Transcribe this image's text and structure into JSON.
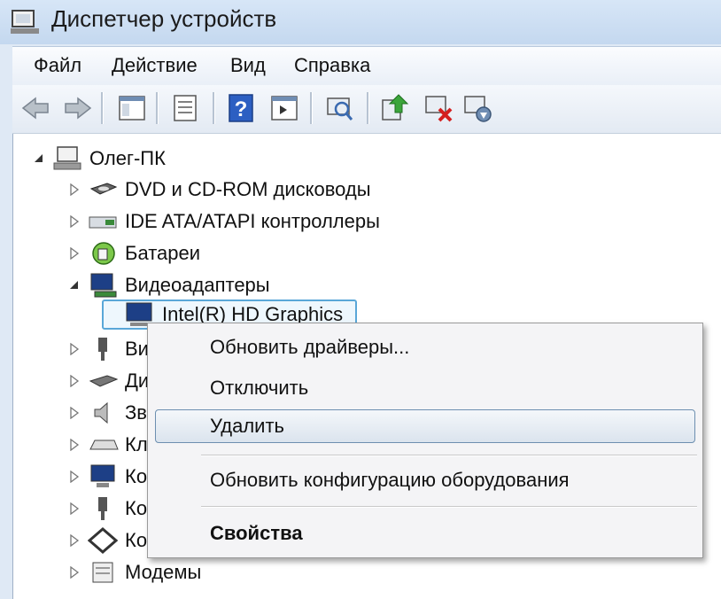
{
  "window": {
    "title": "Диспетчер устройств"
  },
  "menu": [
    "Файл",
    "Действие",
    "Вид",
    "Справка"
  ],
  "toolbar": {
    "buttons": [
      "back-icon",
      "forward-icon",
      "properties-window-icon",
      "list-view-icon",
      "help-icon",
      "panel-view-icon",
      "scan-hardware-icon",
      "update-driver-icon",
      "disable-device-icon",
      "uninstall-device-icon"
    ]
  },
  "tree": {
    "root": "Олег-ПК",
    "items": [
      {
        "label": "DVD и CD-ROM дисководы",
        "icon": "dvd-drive-icon"
      },
      {
        "label": "IDE ATA/ATAPI контроллеры",
        "icon": "ide-controller-icon"
      },
      {
        "label": "Батареи",
        "icon": "battery-icon"
      },
      {
        "label": "Видеоадаптеры",
        "icon": "display-adapter-icon"
      },
      {
        "label": "Intel(R) HD Graphics",
        "icon": "monitor-icon"
      },
      {
        "label": "Ви",
        "icon": "usb-plug-icon"
      },
      {
        "label": "Ди",
        "icon": "disk-drive-icon"
      },
      {
        "label": "Зв",
        "icon": "speaker-icon"
      },
      {
        "label": "Кл",
        "icon": "keyboard-icon"
      },
      {
        "label": "Ко",
        "icon": "computer-icon"
      },
      {
        "label": "Ко",
        "icon": "usb-controller-icon"
      },
      {
        "label": "Ко",
        "icon": "network-icon"
      },
      {
        "label": "Модемы",
        "icon": "modem-icon"
      }
    ]
  },
  "context_menu": {
    "update_drivers": "Обновить драйверы...",
    "disable": "Отключить",
    "uninstall": "Удалить",
    "scan": "Обновить конфигурацию оборудования",
    "properties": "Свойства"
  }
}
